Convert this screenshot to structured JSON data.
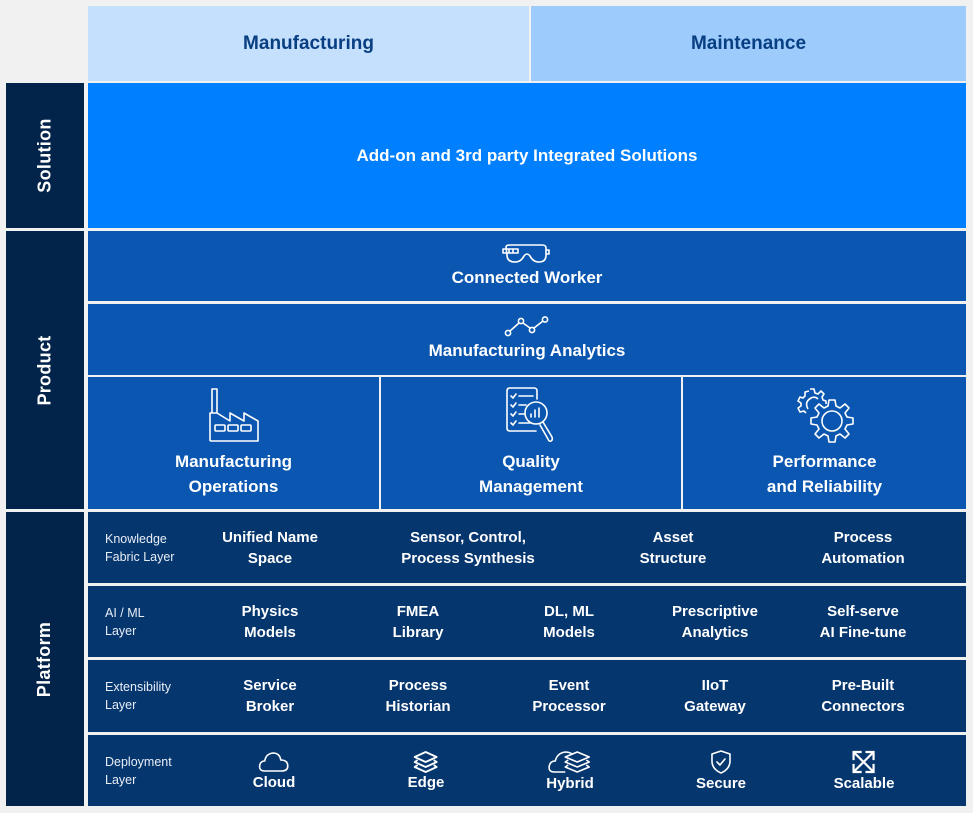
{
  "header": {
    "columns": [
      {
        "label": "Manufacturing",
        "color": "#c5e0fc"
      },
      {
        "label": "Maintenance",
        "color": "#9ccbfc"
      }
    ]
  },
  "sections": {
    "solution": {
      "label": "Solution",
      "content": "Add-on and 3rd party Integrated Solutions"
    },
    "product": {
      "label": "Product",
      "connected_worker": {
        "icon": "goggles-icon",
        "label": "Connected Worker"
      },
      "manufacturing_analytics": {
        "icon": "line-chart-icon",
        "label": "Manufacturing Analytics"
      },
      "modules": [
        {
          "icon": "factory-icon",
          "line1": "Manufacturing",
          "line2": "Operations"
        },
        {
          "icon": "quality-checklist-icon",
          "line1": "Quality",
          "line2": "Management"
        },
        {
          "icon": "gears-icon",
          "line1": "Performance",
          "line2": "and Reliability"
        }
      ]
    },
    "platform": {
      "label": "Platform",
      "layers": [
        {
          "line1": "Knowledge",
          "line2": "Fabric Layer",
          "items": [
            {
              "line1": "Unified Name",
              "line2": "Space"
            },
            {
              "line1": "Sensor, Control,",
              "line2": "Process Synthesis"
            },
            {
              "line1": "Asset",
              "line2": "Structure"
            },
            {
              "line1": "Process",
              "line2": "Automation"
            }
          ]
        },
        {
          "line1": "AI / ML",
          "line2": "Layer",
          "items": [
            {
              "line1": "Physics",
              "line2": "Models"
            },
            {
              "line1": "FMEA",
              "line2": "Library"
            },
            {
              "line1": "DL, ML",
              "line2": "Models"
            },
            {
              "line1": "Prescriptive",
              "line2": "Analytics"
            },
            {
              "line1": "Self-serve",
              "line2": "AI Fine-tune"
            }
          ]
        },
        {
          "line1": "Extensibility",
          "line2": "Layer",
          "items": [
            {
              "line1": "Service",
              "line2": "Broker"
            },
            {
              "line1": "Process",
              "line2": "Historian"
            },
            {
              "line1": "Event",
              "line2": "Processor"
            },
            {
              "line1": "IIoT",
              "line2": "Gateway"
            },
            {
              "line1": "Pre-Built",
              "line2": "Connectors"
            }
          ]
        },
        {
          "line1": "Deployment",
          "line2": "Layer",
          "items": [
            {
              "icon": "cloud-icon",
              "label": "Cloud"
            },
            {
              "icon": "layers-icon",
              "label": "Edge"
            },
            {
              "icon": "hybrid-cloud-icon",
              "label": "Hybrid"
            },
            {
              "icon": "shield-check-icon",
              "label": "Secure"
            },
            {
              "icon": "expand-arrows-icon",
              "label": "Scalable"
            }
          ]
        }
      ]
    }
  },
  "colors": {
    "side_label": "#03244a",
    "solution": "#0080ff",
    "product": "#0a56b0",
    "platform": "#06366e",
    "header_text": "#083f82"
  }
}
